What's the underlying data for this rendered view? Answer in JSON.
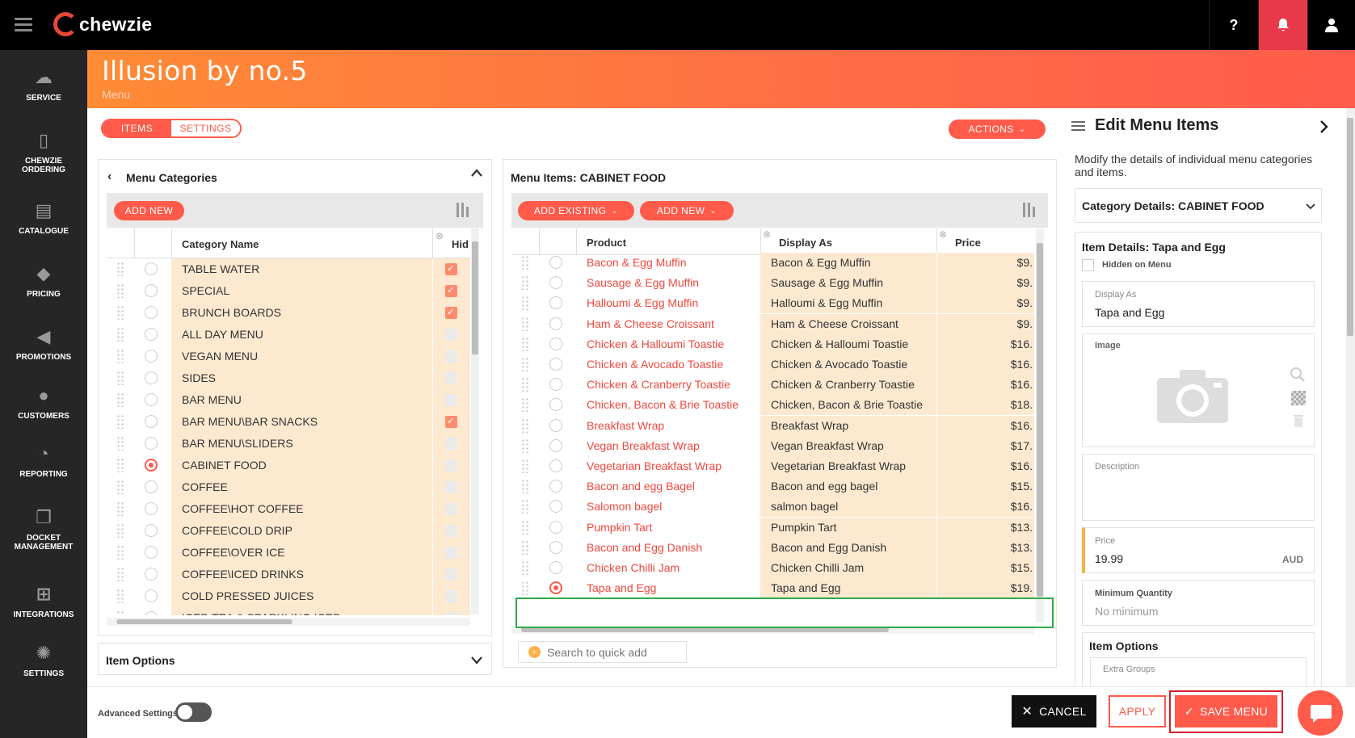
{
  "app": {
    "logo_text": "chewzie"
  },
  "topbar": {
    "help_label": "?",
    "bell_label": "🔔",
    "user_label": "👤"
  },
  "sidebar": {
    "items": [
      {
        "label": "SERVICE",
        "icon": "service-icon",
        "glyph": "☁"
      },
      {
        "label": "CHEWZIE",
        "label2": "ORDERING",
        "icon": "phone-order-icon",
        "glyph": "▯"
      },
      {
        "label": "CATALOGUE",
        "icon": "catalogue-icon",
        "glyph": "▤"
      },
      {
        "label": "PRICING",
        "icon": "tag-icon",
        "glyph": "◆"
      },
      {
        "label": "PROMOTIONS",
        "icon": "megaphone-icon",
        "glyph": "◀"
      },
      {
        "label": "CUSTOMERS",
        "icon": "customers-icon",
        "glyph": "●"
      },
      {
        "label": "REPORTING",
        "icon": "pie-chart-icon",
        "glyph": "◔"
      },
      {
        "label": "DOCKET",
        "label2": "MANAGEMENT",
        "icon": "docket-icon",
        "glyph": "❐"
      },
      {
        "label": "INTEGRATIONS",
        "icon": "integrations-icon",
        "glyph": "⊞"
      },
      {
        "label": "SETTINGS",
        "icon": "gear-icon",
        "glyph": "✺"
      }
    ]
  },
  "header": {
    "title": "Illusion by no.5",
    "subtitle": "Menu"
  },
  "tabs": {
    "items": "ITEMS",
    "settings": "SETTINGS"
  },
  "actions_label": "ACTIONS",
  "categories_panel": {
    "title": "Menu Categories",
    "add_new": "ADD NEW",
    "col_name": "Category Name",
    "col_hidden": "Hid",
    "rows": [
      {
        "name": "TABLE WATER",
        "hidden": true,
        "selected": false
      },
      {
        "name": "SPECIAL",
        "hidden": true,
        "selected": false
      },
      {
        "name": "BRUNCH BOARDS",
        "hidden": true,
        "selected": false
      },
      {
        "name": "ALL DAY MENU",
        "hidden": false,
        "selected": false
      },
      {
        "name": "VEGAN MENU",
        "hidden": false,
        "selected": false
      },
      {
        "name": "SIDES",
        "hidden": false,
        "selected": false
      },
      {
        "name": "BAR MENU",
        "hidden": false,
        "selected": false
      },
      {
        "name": "BAR MENU\\BAR SNACKS",
        "hidden": true,
        "selected": false
      },
      {
        "name": "BAR MENU\\SLIDERS",
        "hidden": false,
        "selected": false
      },
      {
        "name": "CABINET FOOD",
        "hidden": false,
        "selected": true
      },
      {
        "name": "COFFEE",
        "hidden": false,
        "selected": false
      },
      {
        "name": "COFFEE\\HOT COFFEE",
        "hidden": false,
        "selected": false
      },
      {
        "name": "COFFEE\\COLD DRIP",
        "hidden": false,
        "selected": false
      },
      {
        "name": "COFFEE\\OVER ICE",
        "hidden": false,
        "selected": false
      },
      {
        "name": "COFFEE\\ICED DRINKS",
        "hidden": false,
        "selected": false
      },
      {
        "name": "COLD PRESSED JUICES",
        "hidden": false,
        "selected": false
      },
      {
        "name": "ICED TEA & SPARKLING ICED",
        "hidden": false,
        "selected": false
      }
    ]
  },
  "item_options_panel": {
    "title": "Item Options"
  },
  "items_panel": {
    "title": "Menu Items: CABINET FOOD",
    "add_existing": "ADD EXISTING",
    "add_new": "ADD NEW",
    "col_product": "Product",
    "col_display": "Display As",
    "col_price": "Price",
    "search_placeholder": "Search to quick add",
    "rows": [
      {
        "product": "Bacon & Egg Muffin",
        "display": "Bacon & Egg Muffin",
        "price": "$9.",
        "selected": false
      },
      {
        "product": "Sausage & Egg Muffin",
        "display": "Sausage & Egg Muffin",
        "price": "$9.",
        "selected": false
      },
      {
        "product": "Halloumi & Egg Muffin",
        "display": "Halloumi & Egg Muffin",
        "price": "$9.",
        "selected": false
      },
      {
        "product": "Ham & Cheese Croissant",
        "display": "Ham & Cheese Croissant",
        "price": "$9.",
        "selected": false
      },
      {
        "product": "Chicken & Halloumi Toastie",
        "display": "Chicken & Halloumi Toastie",
        "price": "$16.",
        "selected": false
      },
      {
        "product": "Chicken & Avocado Toastie",
        "display": "Chicken & Avocado Toastie",
        "price": "$16.",
        "selected": false
      },
      {
        "product": "Chicken & Cranberry Toastie",
        "display": "Chicken & Cranberry Toastie",
        "price": "$16.",
        "selected": false
      },
      {
        "product": "Chicken, Bacon & Brie Toastie",
        "display": "Chicken, Bacon & Brie Toastie",
        "price": "$18.",
        "selected": false
      },
      {
        "product": "Breakfast Wrap",
        "display": "Breakfast Wrap",
        "price": "$16.",
        "selected": false
      },
      {
        "product": "Vegan Breakfast Wrap",
        "display": "Vegan Breakfast Wrap",
        "price": "$17.",
        "selected": false
      },
      {
        "product": "Vegetarian Breakfast Wrap",
        "display": "Vegetarian Breakfast Wrap",
        "price": "$16.",
        "selected": false
      },
      {
        "product": "Bacon and egg Bagel",
        "display": "Bacon and egg bagel",
        "price": "$15.",
        "selected": false
      },
      {
        "product": "Salomon bagel",
        "display": "salmon bagel",
        "price": "$16.",
        "selected": false
      },
      {
        "product": "Pumpkin Tart",
        "display": "Pumpkin Tart",
        "price": "$13.",
        "selected": false
      },
      {
        "product": "Bacon and Egg Danish",
        "display": "Bacon and Egg Danish",
        "price": "$13.",
        "selected": false
      },
      {
        "product": "Chicken Chilli Jam",
        "display": "Chicken Chilli Jam",
        "price": "$15.",
        "selected": false
      },
      {
        "product": "Tapa and Egg",
        "display": "Tapa and Egg",
        "price": "$19.",
        "selected": true
      }
    ]
  },
  "edit_panel": {
    "title": "Edit Menu Items",
    "description": "Modify the details of individual menu categories and items.",
    "category_details": "Category Details: CABINET FOOD",
    "item_details": "Item Details: Tapa and Egg",
    "hidden_on_menu": "Hidden on Menu",
    "display_as_label": "Display As",
    "display_as_value": "Tapa and Egg",
    "image_label": "Image",
    "description_label": "Description",
    "price_label": "Price",
    "price_value": "19.99",
    "currency": "AUD",
    "min_qty_label": "Minimum Quantity",
    "min_qty_placeholder": "No minimum",
    "item_options": "Item Options",
    "extra_groups": "Extra Groups"
  },
  "bottom": {
    "advanced_settings": "Advanced Settings",
    "cancel": "CANCEL",
    "apply": "APPLY",
    "save_menu": "SAVE MENU"
  },
  "colors": {
    "accent": "#ff5a4a",
    "row_bg": "#fde9d0",
    "link_red": "#f0483e",
    "highlight_green": "#2eaa4a",
    "save_outline": "#d21f2e"
  }
}
